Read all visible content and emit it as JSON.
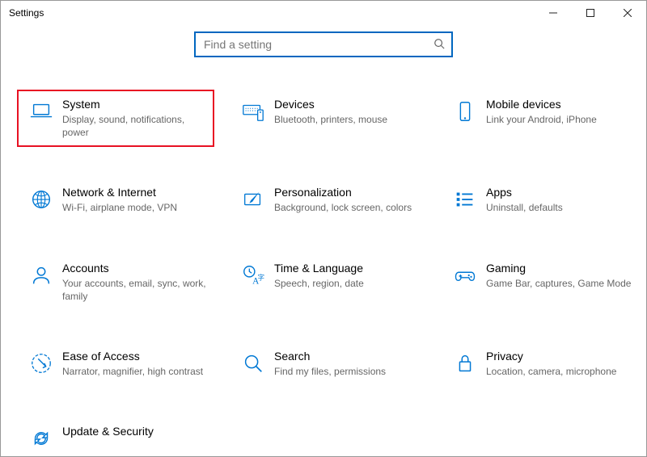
{
  "window": {
    "title": "Settings"
  },
  "search": {
    "placeholder": "Find a setting",
    "value": ""
  },
  "tiles": {
    "system": {
      "title": "System",
      "desc": "Display, sound, notifications, power"
    },
    "devices": {
      "title": "Devices",
      "desc": "Bluetooth, printers, mouse"
    },
    "mobile": {
      "title": "Mobile devices",
      "desc": "Link your Android, iPhone"
    },
    "network": {
      "title": "Network & Internet",
      "desc": "Wi-Fi, airplane mode, VPN"
    },
    "personalization": {
      "title": "Personalization",
      "desc": "Background, lock screen, colors"
    },
    "apps": {
      "title": "Apps",
      "desc": "Uninstall, defaults"
    },
    "accounts": {
      "title": "Accounts",
      "desc": "Your accounts, email, sync, work, family"
    },
    "time": {
      "title": "Time & Language",
      "desc": "Speech, region, date"
    },
    "gaming": {
      "title": "Gaming",
      "desc": "Game Bar, captures, Game Mode"
    },
    "ease": {
      "title": "Ease of Access",
      "desc": "Narrator, magnifier, high contrast"
    },
    "searchCat": {
      "title": "Search",
      "desc": "Find my files, permissions"
    },
    "privacy": {
      "title": "Privacy",
      "desc": "Location, camera, microphone"
    },
    "update": {
      "title": "Update & Security",
      "desc": ""
    }
  }
}
